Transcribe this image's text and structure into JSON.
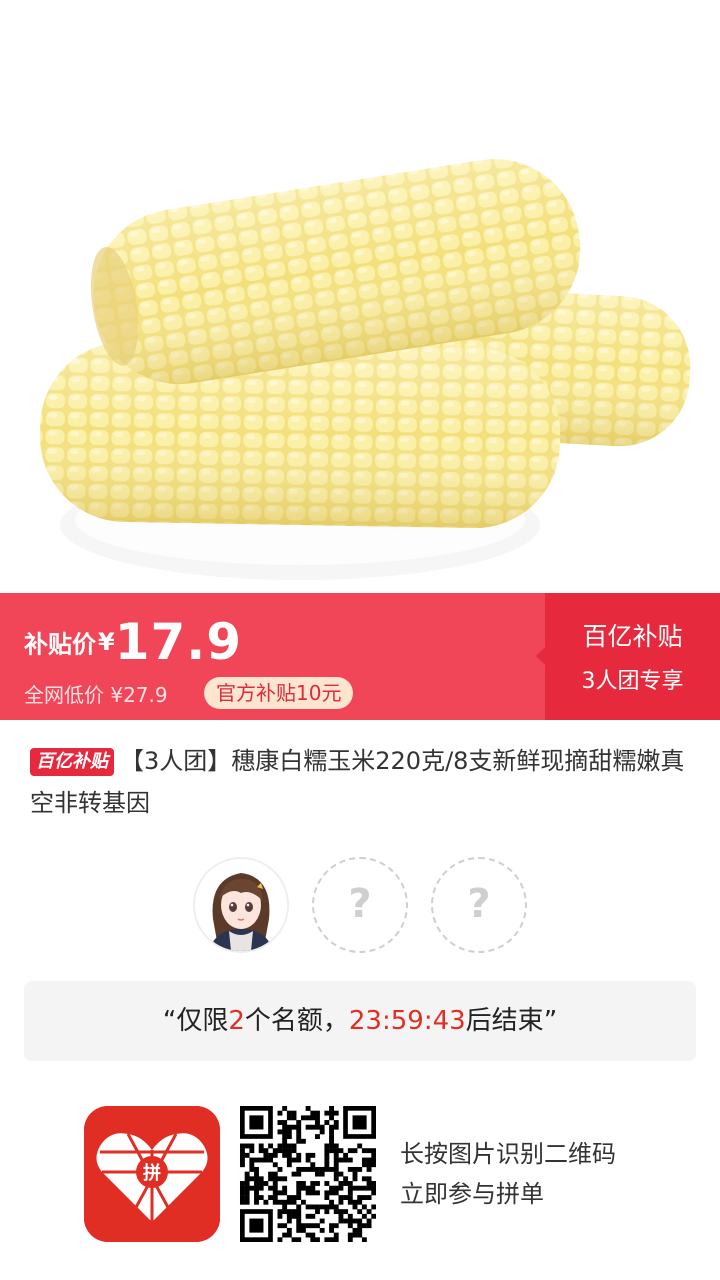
{
  "product": {
    "image_subject": "corn",
    "title_badge": "百亿补贴",
    "title": "【3人团】穗康白糯玉米220克/8支新鲜现摘甜糯嫩真空非转基因"
  },
  "price_banner": {
    "label": "补贴价",
    "currency": "¥",
    "price": "17.9",
    "original_label": "全网低价 ¥27.9",
    "subsidy_pill": "官方补贴10元",
    "right_title": "百亿补贴",
    "right_subtitle": "3人团专享",
    "colors": {
      "left_bg": "#f14558",
      "right_bg": "#e7293e",
      "pill_bg": "#fde5d0"
    }
  },
  "group": {
    "empty_slot_symbol": "?",
    "slots": [
      "user-avatar",
      "empty",
      "empty"
    ]
  },
  "notice": {
    "open_quote": "“",
    "prefix": "仅限",
    "count": "2",
    "middle": "个名额，",
    "countdown": "23:59:43",
    "suffix": "后结束",
    "close_quote": "”"
  },
  "footer": {
    "logo_char": "拼",
    "scan_line1": "长按图片识别二维码",
    "scan_line2": "立即参与拼单"
  }
}
